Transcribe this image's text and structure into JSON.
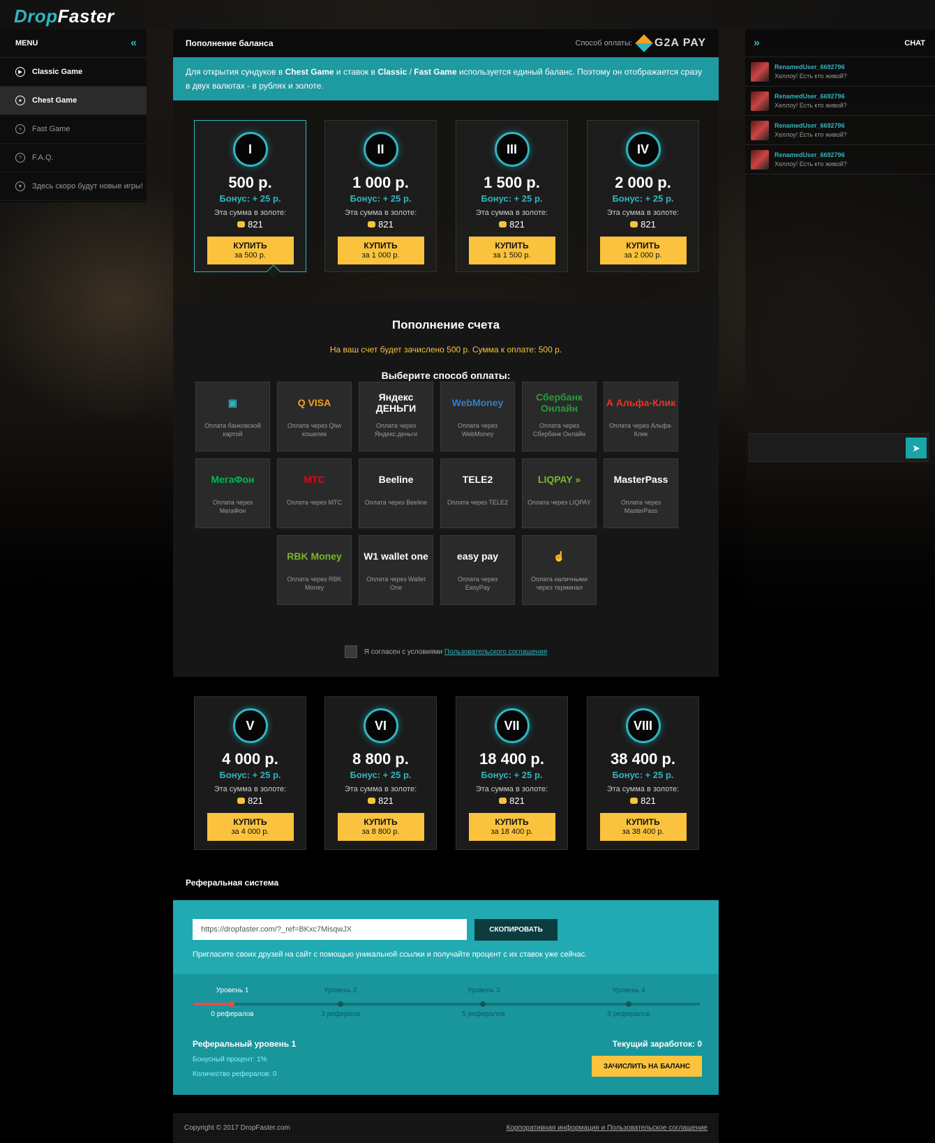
{
  "brand": {
    "part1": "Drop",
    "part2": "Faster"
  },
  "menu": {
    "title": "MENU",
    "items": [
      {
        "label": "Classic Game",
        "style": "bold"
      },
      {
        "label": "Chest Game",
        "style": "active"
      },
      {
        "label": "Fast Game",
        "style": "dim"
      },
      {
        "label": "F.A.Q.",
        "style": "dim"
      },
      {
        "label": "Здесь скоро будут новые игры!",
        "style": "dim"
      }
    ]
  },
  "chat": {
    "title": "CHAT",
    "messages": [
      {
        "user": "RenamedUser_6692796",
        "text": "Хеллоу! Есть кто живой?"
      },
      {
        "user": "RenamedUser_6692796",
        "text": "Хеллоу! Есть кто живой?"
      },
      {
        "user": "RenamedUser_6692796",
        "text": "Хеллоу! Есть кто живой?"
      },
      {
        "user": "RenamedUser_6692796",
        "text": "Хеллоу! Есть кто живой?"
      }
    ],
    "input_value": ""
  },
  "header": {
    "title": "Пополнение баланса",
    "payment_label": "Способ оплаты:",
    "payment_brand": "G2A PAY"
  },
  "info": {
    "p1": "Для открытия сундуков в ",
    "b1": "Chest Game",
    "p2": " и ставок в ",
    "b2": "Classic",
    "p3": " / ",
    "b3": "Fast Game",
    "p4": " используется единый баланс. Поэтому он отображается сразу в двух валютах - в рублях и золоте."
  },
  "packages": [
    {
      "badge": "I",
      "amount": "500 р.",
      "bonus": "Бонус: + 25 р.",
      "gold_label": "Эта сумма в золоте:",
      "gold": "821",
      "buy": "КУПИТЬ",
      "buy_sub": "за 500 р."
    },
    {
      "badge": "II",
      "amount": "1 000 р.",
      "bonus": "Бонус: + 25 р.",
      "gold_label": "Эта сумма в золоте:",
      "gold": "821",
      "buy": "КУПИТЬ",
      "buy_sub": "за 1 000 р."
    },
    {
      "badge": "III",
      "amount": "1 500 р.",
      "bonus": "Бонус: + 25 р.",
      "gold_label": "Эта сумма в золоте:",
      "gold": "821",
      "buy": "КУПИТЬ",
      "buy_sub": "за 1 500 р."
    },
    {
      "badge": "IV",
      "amount": "2 000 р.",
      "bonus": "Бонус: + 25 р.",
      "gold_label": "Эта сумма в золоте:",
      "gold": "821",
      "buy": "КУПИТЬ",
      "buy_sub": "за 2 000 р."
    },
    {
      "badge": "V",
      "amount": "4 000 р.",
      "bonus": "Бонус: + 25 р.",
      "gold_label": "Эта сумма в золоте:",
      "gold": "821",
      "buy": "КУПИТЬ",
      "buy_sub": "за 4 000 р."
    },
    {
      "badge": "VI",
      "amount": "8 800 р.",
      "bonus": "Бонус: + 25 р.",
      "gold_label": "Эта сумма в золоте:",
      "gold": "821",
      "buy": "КУПИТЬ",
      "buy_sub": "за 8 800 р."
    },
    {
      "badge": "VII",
      "amount": "18 400 р.",
      "bonus": "Бонус: + 25 р.",
      "gold_label": "Эта сумма в золоте:",
      "gold": "821",
      "buy": "КУПИТЬ",
      "buy_sub": "за 18 400 р."
    },
    {
      "badge": "VIII",
      "amount": "38 400 р.",
      "bonus": "Бонус: + 25 р.",
      "gold_label": "Эта сумма в золоте:",
      "gold": "821",
      "buy": "КУПИТЬ",
      "buy_sub": "за 38 400 р."
    }
  ],
  "topup": {
    "title": "Пополнение счета",
    "note": "На ваш счет будет зачислено 500 р. Сумма к оплате: 500 р.",
    "choose": "Выберите  способ оплаты:",
    "methods": [
      {
        "logo": "▣",
        "logo_color": "#2fb6c0",
        "caption": "Оплата банковской картой"
      },
      {
        "logo": "Q VISA",
        "logo_color": "#f7a01d",
        "caption": "Оплата через Qiwi кошелек"
      },
      {
        "logo": "Яндекс ДЕНЬГИ",
        "logo_color": "#ffffff",
        "caption": "Оплата через Яндекс.деньги"
      },
      {
        "logo": "WebMoney",
        "logo_color": "#2d7fd3",
        "caption": "Оплата через WebMoney"
      },
      {
        "logo": "Сбербанк Онлайн",
        "logo_color": "#21a038",
        "caption": "Оплата через Сбербанк Онлайн"
      },
      {
        "logo": "А Альфа-Клик",
        "logo_color": "#ef3124",
        "caption": "Оплата через Альфа-Клик"
      },
      {
        "logo": "МегаФон",
        "logo_color": "#00b956",
        "caption": "Оплата  через МегаФон"
      },
      {
        "logo": "МТС",
        "logo_color": "#e30611",
        "caption": "Оплата через МТС"
      },
      {
        "logo": "Beeline",
        "logo_color": "#ffffff",
        "caption": "Оплата через Beeline"
      },
      {
        "logo": "TELE2",
        "logo_color": "#ffffff",
        "caption": "Оплата через TELE2"
      },
      {
        "logo": "LIQPAY »",
        "logo_color": "#7ab72b",
        "caption": "Оплата через LIQPAY"
      },
      {
        "logo": "MasterPass",
        "logo_color": "#ffffff",
        "caption": "Оплата через MasterPass"
      },
      {
        "logo": "RBK Money",
        "logo_color": "#7ab72b",
        "caption": "Оплата через RBK Money"
      },
      {
        "logo": "W1 wallet one",
        "logo_color": "#ffffff",
        "caption": "Оплата через Wallet One"
      },
      {
        "logo": "easy pay",
        "logo_color": "#ffffff",
        "caption": "Оплата через EasyPay"
      },
      {
        "logo": "☝",
        "logo_color": "#2fb6c0",
        "caption": "Оплата наличными через терминал"
      }
    ],
    "agree_text": "Я согласен с условиями ",
    "agree_link": "Пользовательского соглашения"
  },
  "referral": {
    "title": "Реферальная система",
    "link": "https://dropfaster.com/?_ref=BKxc7MisqwJX",
    "copy_label": "СКОПИРОВАТЬ",
    "note": "Пригласите своих друзей на сайт с помощью уникальной ссылки и получайте процент с их ставок уже сейчас.",
    "progress": 0.08,
    "levels": [
      {
        "name": "Уровень 1",
        "count": "0 рефералов",
        "active": true
      },
      {
        "name": "Уровень 2",
        "count": "3 реферала",
        "active": false
      },
      {
        "name": "Уровень 3",
        "count": "5 рефералов",
        "active": false
      },
      {
        "name": "Уровень 4",
        "count": "8 рефералов",
        "active": false
      }
    ],
    "level_title": "Реферальный уровень 1",
    "bonus_percent": "Бонусный процент: 1%",
    "ref_count": "Количество рефералов: 0",
    "earnings": "Текущий заработок: 0",
    "credit_label": "ЗАЧИСЛИТЬ НА БАЛАНС"
  },
  "footer": {
    "copyright": "Copyright © 2017 DropFaster.com",
    "link": "Корпоративная информация и Пользовательское соглашение"
  }
}
